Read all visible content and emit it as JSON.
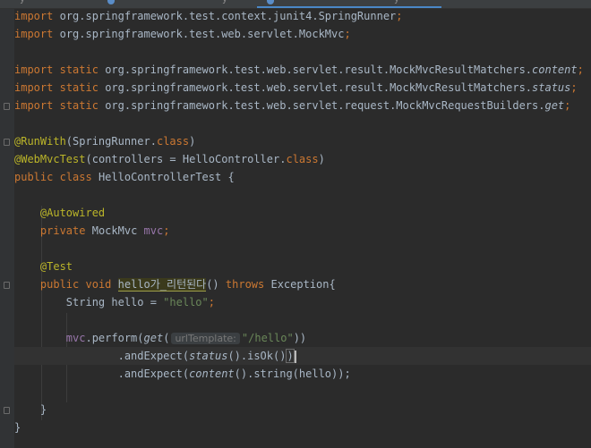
{
  "tabs": [
    {
      "fragment": "y",
      "active": false
    },
    {
      "fragment": "",
      "active": false
    },
    {
      "fragment": "y",
      "active": false
    },
    {
      "fragment": "y",
      "active": true
    }
  ],
  "editor": {
    "imports": [
      "org.springframework.test.context.junit4.SpringRunner",
      "org.springframework.test.web.servlet.MockMvc"
    ],
    "static_imports": [
      {
        "path": "org.springframework.test.web.servlet.result.MockMvcResultMatchers.",
        "member": "content"
      },
      {
        "path": "org.springframework.test.web.servlet.result.MockMvcResultMatchers.",
        "member": "status"
      },
      {
        "path": "org.springframework.test.web.servlet.request.MockMvcRequestBuilders.",
        "member": "get"
      }
    ],
    "kw_import": "import",
    "kw_static": "static",
    "kw_class": "class",
    "kw_public": "public",
    "kw_private": "private",
    "kw_void": "void",
    "kw_throws": "throws",
    "semicolon": ";",
    "runwith_ann": "@RunWith",
    "runwith_arg": "SpringRunner",
    "webmvc_ann": "@WebMvcTest",
    "webmvc_param": "controllers = HelloController",
    "class_decl_name": "HelloControllerTest {",
    "autowired_ann": "@Autowired",
    "field_type": "MockMvc",
    "field_name": "mvc",
    "test_ann": "@Test",
    "method_name": "hello가_리턴된다",
    "method_params": "()",
    "exception_type": "Exception{",
    "string_decl": "String hello = ",
    "string_value": "\"hello\"",
    "perform_call": ".perform(",
    "get_call": "get",
    "param_hint": "urlTemplate:",
    "url_value": "\"/hello\"",
    "and_expect": ".andExpect(",
    "status_call": "status",
    "isok_call": "().isOk()",
    "content_call": "content",
    "string_call": "().string(hello));",
    "close_brace": "}"
  }
}
